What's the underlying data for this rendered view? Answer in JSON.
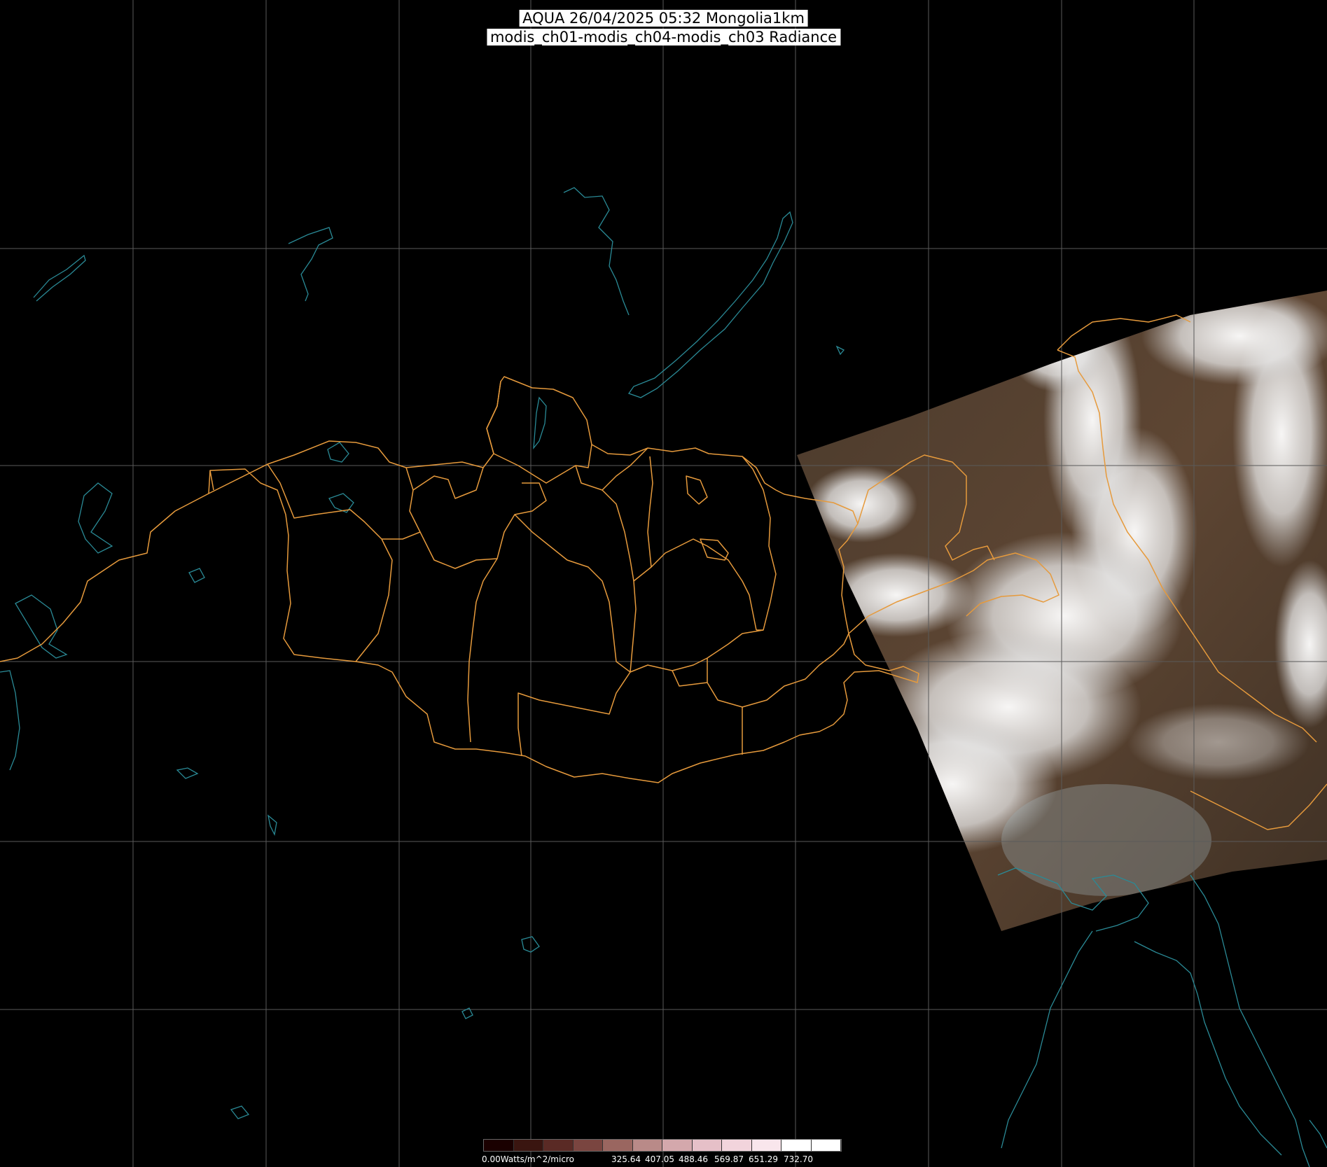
{
  "header": {
    "title_line1": "AQUA 26/04/2025 05:32 Mongolia1km",
    "title_line2": "modis_ch01-modis_ch04-modis_ch03 Radiance"
  },
  "map": {
    "background_color": "#000000",
    "gridline_color": "#5a5a5a",
    "admin_border_color": "#e69a3c",
    "coastline_color": "#2a8a96",
    "cloud_color": "#f2f2f2",
    "land_color": "#5a4331"
  },
  "legend": {
    "min_label": "0.00Watts/m^2/micro",
    "tick_labels": [
      "325.64",
      "407.05",
      "488.46",
      "569.87",
      "651.29",
      "732.70"
    ],
    "colors": [
      "#1a0000",
      "#3a1510",
      "#5a2a25",
      "#7a4540",
      "#9a6660",
      "#b98a88",
      "#d4a8ac",
      "#e6c0c8",
      "#f2d4dc",
      "#f9e6ec",
      "#ffffff",
      "#ffffff"
    ]
  }
}
